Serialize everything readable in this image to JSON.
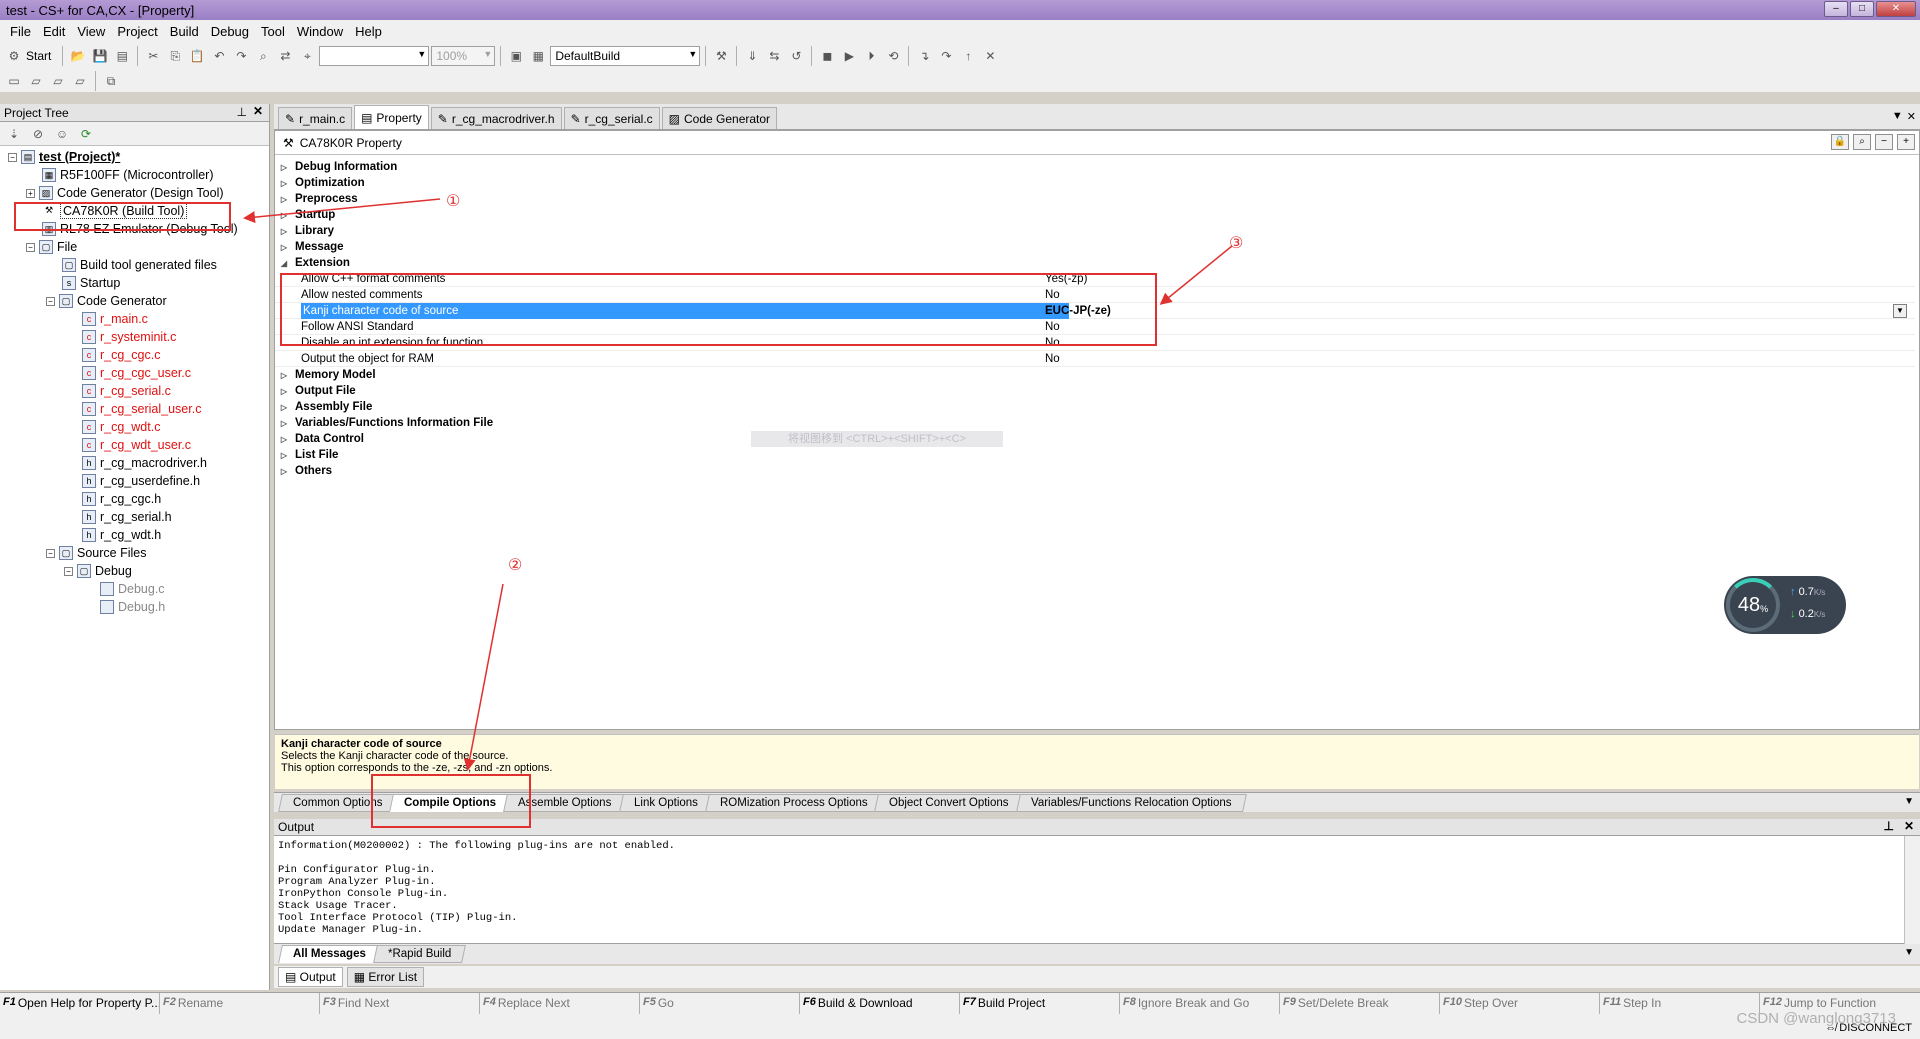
{
  "window": {
    "title": "test - CS+ for CA,CX - [Property]"
  },
  "menu": [
    "File",
    "Edit",
    "View",
    "Project",
    "Build",
    "Debug",
    "Tool",
    "Window",
    "Help"
  ],
  "toolbar": {
    "start_label": "Start",
    "zoom_value": "100%",
    "build_config": "DefaultBuild"
  },
  "project_tree": {
    "title": "Project Tree",
    "nodes": [
      {
        "label": "test (Project)*",
        "style": "bold-underline"
      },
      {
        "label": "R5F100FF (Microcontroller)"
      },
      {
        "label": "Code Generator (Design Tool)"
      },
      {
        "label": "CA78K0R (Build Tool)"
      },
      {
        "label": "RL78 EZ Emulator (Debug Tool)"
      },
      {
        "label": "File"
      },
      {
        "label": "Build tool generated files"
      },
      {
        "label": "Startup"
      },
      {
        "label": "Code Generator"
      },
      {
        "label": "r_main.c",
        "color": "red"
      },
      {
        "label": "r_systeminit.c",
        "color": "red"
      },
      {
        "label": "r_cg_cgc.c",
        "color": "red"
      },
      {
        "label": "r_cg_cgc_user.c",
        "color": "red"
      },
      {
        "label": "r_cg_serial.c",
        "color": "red"
      },
      {
        "label": "r_cg_serial_user.c",
        "color": "red"
      },
      {
        "label": "r_cg_wdt.c",
        "color": "red"
      },
      {
        "label": "r_cg_wdt_user.c",
        "color": "red"
      },
      {
        "label": "r_cg_macrodriver.h"
      },
      {
        "label": "r_cg_userdefine.h"
      },
      {
        "label": "r_cg_cgc.h"
      },
      {
        "label": "r_cg_serial.h"
      },
      {
        "label": "r_cg_wdt.h"
      },
      {
        "label": "Source Files"
      },
      {
        "label": "Debug"
      },
      {
        "label": "Debug.c",
        "color": "gray"
      },
      {
        "label": "Debug.h",
        "color": "gray"
      }
    ]
  },
  "editor_tabs": [
    "r_main.c",
    "Property",
    "r_cg_macrodriver.h",
    "r_cg_serial.c",
    "Code Generator"
  ],
  "property": {
    "header": "CA78K0R Property",
    "categories_top": [
      "Debug Information",
      "Optimization",
      "Preprocess",
      "Startup",
      "Library",
      "Message",
      "Extension"
    ],
    "extension_items": [
      {
        "label": "Allow C++ format comments",
        "value": "Yes(-zp)"
      },
      {
        "label": "Allow nested comments",
        "value": "No"
      },
      {
        "label": "Kanji character code of source",
        "value": "EUC-JP(-ze)",
        "selected": true
      },
      {
        "label": "Follow ANSI Standard",
        "value": "No"
      },
      {
        "label": "Disable an int extension for function",
        "value": "No"
      },
      {
        "label": "Output the object for RAM",
        "value": "No"
      }
    ],
    "categories_bottom": [
      "Memory Model",
      "Output File",
      "Assembly File",
      "Variables/Functions Information File",
      "Data Control",
      "List File",
      "Others"
    ],
    "ghost_hint": "将视图移到 <CTRL>+<SHIFT>+<C>",
    "description": {
      "title": "Kanji character code of source",
      "line1": "Selects the Kanji character code of the source.",
      "line2": "This option corresponds to the -ze, -zs, and -zn options."
    }
  },
  "option_tabs": [
    "Common Options",
    "Compile Options",
    "Assemble Options",
    "Link Options",
    "ROMization Process Options",
    "Object Convert Options",
    "Variables/Functions Relocation Options"
  ],
  "output": {
    "title": "Output",
    "lines": [
      "Information(M0200002) : The following plug-ins are not enabled.",
      "",
      "Pin Configurator Plug-in.",
      "Program Analyzer Plug-in.",
      "IronPython Console Plug-in.",
      "Stack Usage Tracer.",
      "Tool Interface Protocol (TIP) Plug-in.",
      "Update Manager Plug-in."
    ],
    "tabs": [
      "All Messages",
      "*Rapid Build"
    ],
    "panel_tabs": [
      "Output",
      "Error List"
    ]
  },
  "fkeys": [
    {
      "key": "F1",
      "label": "Open Help for Property P..."
    },
    {
      "key": "F2",
      "label": "Rename"
    },
    {
      "key": "F3",
      "label": "Find Next"
    },
    {
      "key": "F4",
      "label": "Replace Next"
    },
    {
      "key": "F5",
      "label": "Go"
    },
    {
      "key": "F6",
      "label": "Build & Download"
    },
    {
      "key": "F7",
      "label": "Build Project"
    },
    {
      "key": "F8",
      "label": "Ignore Break and Go"
    },
    {
      "key": "F9",
      "label": "Set/Delete Break"
    },
    {
      "key": "F10",
      "label": "Step Over"
    },
    {
      "key": "F11",
      "label": "Step In"
    },
    {
      "key": "F12",
      "label": "Jump to Function"
    }
  ],
  "status": {
    "disconnect": "DISCONNECT"
  },
  "annotations": [
    "①",
    "②",
    "③"
  ],
  "net_widget": {
    "percent": "48",
    "unit": "%",
    "up": "0.7",
    "down": "0.2",
    "rate_unit": "K/s"
  },
  "watermark": "CSDN @wanglong3713"
}
